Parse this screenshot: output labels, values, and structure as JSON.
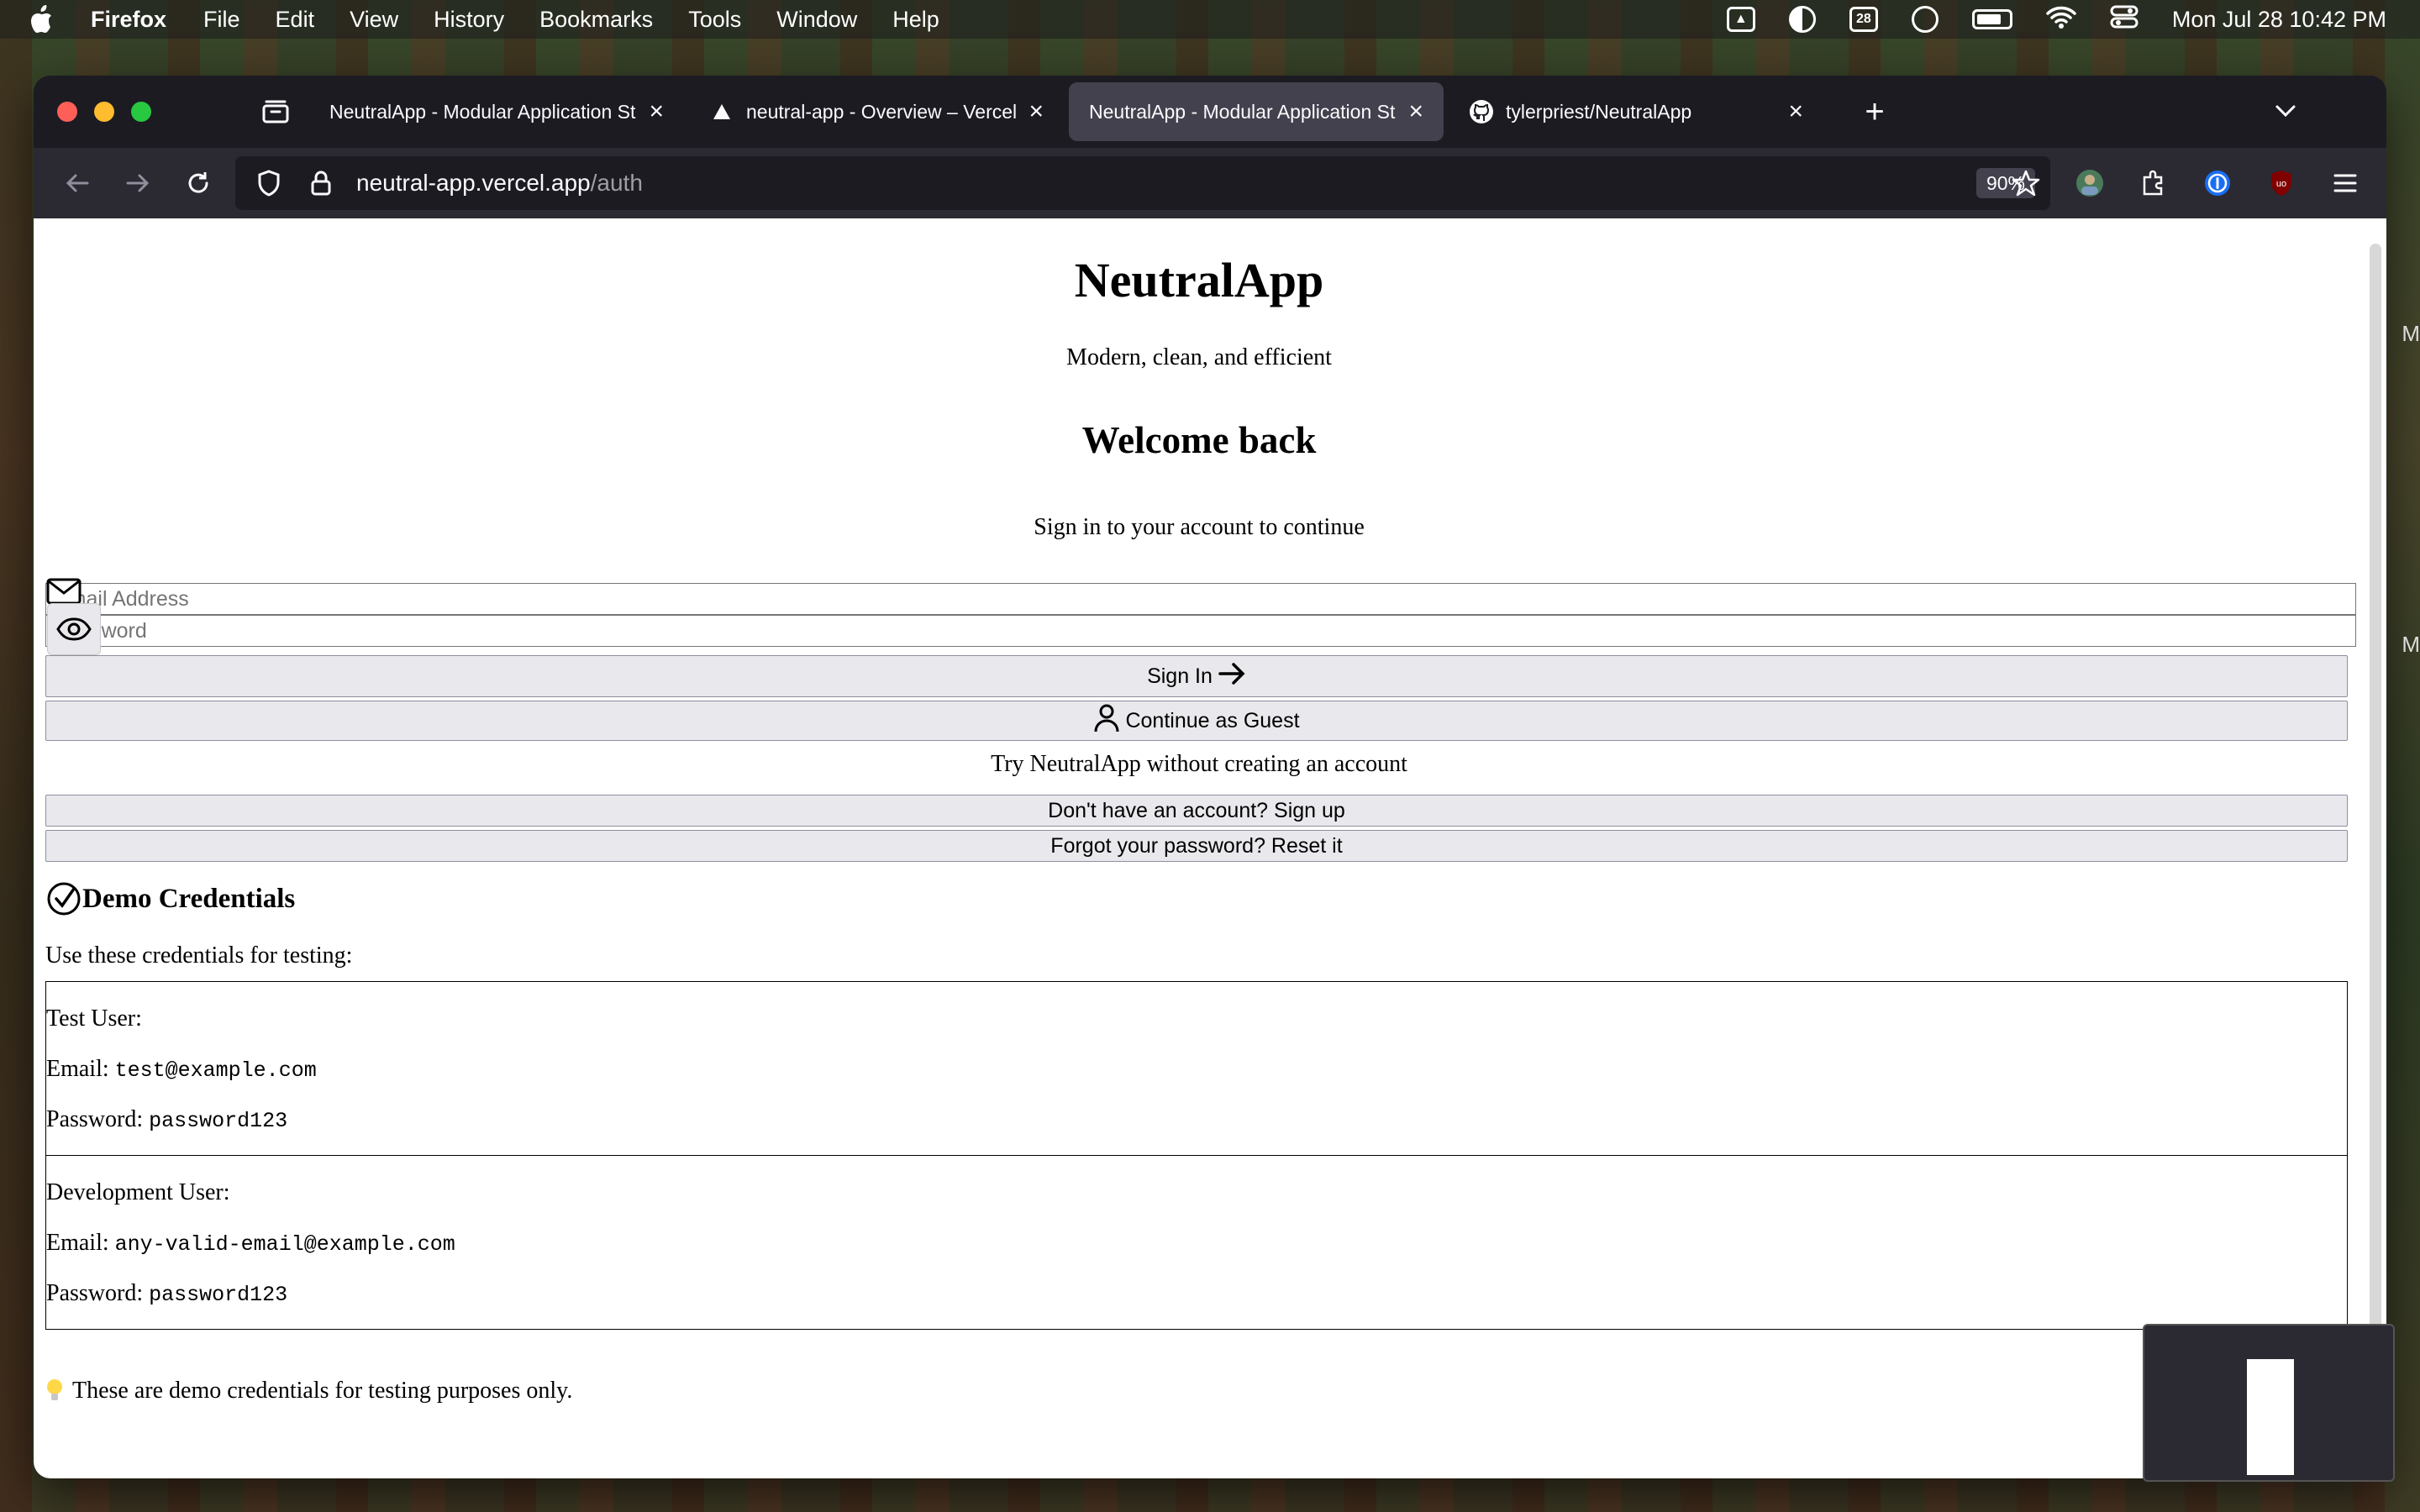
{
  "menubar": {
    "app_name": "Firefox",
    "menus": [
      "File",
      "Edit",
      "View",
      "History",
      "Bookmarks",
      "Tools",
      "Window",
      "Help"
    ],
    "calendar_day": "28",
    "clock": "Mon Jul 28  10:42 PM"
  },
  "tabs": [
    {
      "title": "NeutralApp - Modular Application St",
      "favicon": "none",
      "active": false
    },
    {
      "title": "neutral-app - Overview – Vercel",
      "favicon": "vercel-triangle-icon",
      "active": false
    },
    {
      "title": "NeutralApp - Modular Application St",
      "favicon": "none",
      "active": true
    },
    {
      "title": "tylerpriest/NeutralApp",
      "favicon": "github-icon",
      "active": false
    }
  ],
  "urlbar": {
    "host": "neutral-app.vercel.app",
    "path": "/auth",
    "zoom": "90%"
  },
  "page": {
    "app_title": "NeutralApp",
    "tagline": "Modern, clean, and efficient",
    "welcome": "Welcome back",
    "signin_sub": "Sign in to your account to continue",
    "email_placeholder": "Email Address",
    "password_placeholder": "Password",
    "signin_label": "Sign In",
    "guest_label": "Continue as Guest",
    "try_text": "Try NeutralApp without creating an account",
    "signup_label": "Don't have an account? Sign up",
    "forgot_label": "Forgot your password? Reset it",
    "demo_heading": "Demo Credentials",
    "demo_sub": "Use these credentials for testing:",
    "credentials": [
      {
        "heading": "Test User:",
        "email_label": "Email:",
        "email": "test@example.com",
        "password_label": "Password:",
        "password": "password123"
      },
      {
        "heading": "Development User:",
        "email_label": "Email:",
        "email": "any-valid-email@example.com",
        "password_label": "Password:",
        "password": "password123"
      }
    ],
    "note": "These are demo credentials for testing purposes only."
  },
  "side_letters": [
    "M",
    "M"
  ]
}
